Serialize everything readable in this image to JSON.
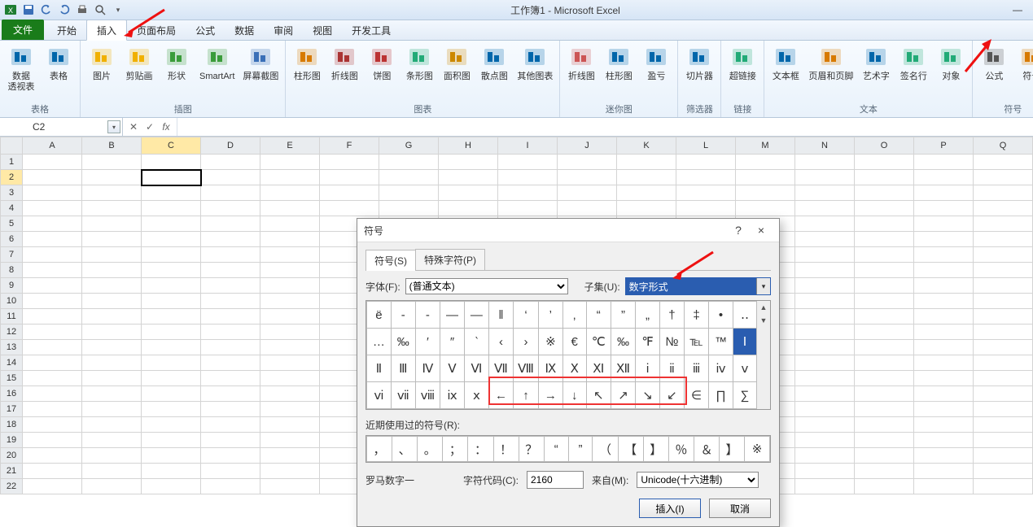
{
  "qat": {
    "title": "工作簿1 - Microsoft Excel"
  },
  "tabs": {
    "file": "文件",
    "items": [
      "开始",
      "插入",
      "页面布局",
      "公式",
      "数据",
      "审阅",
      "视图",
      "开发工具"
    ],
    "active_index": 1
  },
  "ribbon": {
    "groups": [
      {
        "label": "表格",
        "items": [
          {
            "name": "pivot",
            "label": "数据\n透视表"
          },
          {
            "name": "table",
            "label": "表格"
          }
        ]
      },
      {
        "label": "插图",
        "items": [
          {
            "name": "picture",
            "label": "图片"
          },
          {
            "name": "clipart",
            "label": "剪贴画"
          },
          {
            "name": "shapes",
            "label": "形状"
          },
          {
            "name": "smartart",
            "label": "SmartArt"
          },
          {
            "name": "screenshot",
            "label": "屏幕截图"
          }
        ]
      },
      {
        "label": "图表",
        "items": [
          {
            "name": "column-chart",
            "label": "柱形图"
          },
          {
            "name": "line-chart",
            "label": "折线图"
          },
          {
            "name": "pie-chart",
            "label": "饼图"
          },
          {
            "name": "bar-chart",
            "label": "条形图"
          },
          {
            "name": "area-chart",
            "label": "面积图"
          },
          {
            "name": "scatter-chart",
            "label": "散点图"
          },
          {
            "name": "other-chart",
            "label": "其他图表"
          }
        ]
      },
      {
        "label": "迷你图",
        "items": [
          {
            "name": "sparkline",
            "label": "折线图"
          },
          {
            "name": "sparkcol",
            "label": "柱形图"
          },
          {
            "name": "sparkwl",
            "label": "盈亏"
          }
        ]
      },
      {
        "label": "筛选器",
        "items": [
          {
            "name": "slicer",
            "label": "切片器"
          }
        ]
      },
      {
        "label": "链接",
        "items": [
          {
            "name": "hyper",
            "label": "超链接"
          }
        ]
      },
      {
        "label": "文本",
        "items": [
          {
            "name": "textbox",
            "label": "文本框"
          },
          {
            "name": "headerfooter",
            "label": "页眉和页脚"
          },
          {
            "name": "wordart",
            "label": "艺术字"
          },
          {
            "name": "sigline",
            "label": "签名行"
          },
          {
            "name": "object",
            "label": "对象"
          }
        ]
      },
      {
        "label": "符号",
        "items": [
          {
            "name": "equation",
            "label": "公式"
          },
          {
            "name": "symbol",
            "label": "符号"
          }
        ]
      }
    ]
  },
  "formula": {
    "namebox": "C2",
    "fx": "fx"
  },
  "sheet": {
    "cols": [
      "A",
      "B",
      "C",
      "D",
      "E",
      "F",
      "G",
      "H",
      "I",
      "J",
      "K",
      "L",
      "M",
      "N",
      "O",
      "P",
      "Q"
    ],
    "rows": 22,
    "sel": "C2"
  },
  "dialog": {
    "title": "符号",
    "help": "?",
    "close": "×",
    "tabs": [
      "符号(S)",
      "特殊字符(P)"
    ],
    "active_tab": 0,
    "font_label": "字体(F):",
    "font_value": "(普通文本)",
    "subset_label": "子集(U):",
    "subset_value": "数字形式",
    "grid": [
      [
        "ё",
        "-",
        "‐",
        "—",
        "―",
        "‖",
        "‘",
        "’",
        "‚",
        "“",
        "”",
        "„",
        "†",
        "‡",
        "•",
        "‥"
      ],
      [
        "…",
        "‰",
        "′",
        "″",
        "‵",
        "‹",
        "›",
        "※",
        "€",
        "℃",
        "‰",
        "℉",
        "№",
        "℡",
        "™",
        "Ⅰ"
      ],
      [
        "Ⅱ",
        "Ⅲ",
        "Ⅳ",
        "Ⅴ",
        "Ⅵ",
        "Ⅶ",
        "Ⅷ",
        "Ⅸ",
        "Ⅹ",
        "Ⅺ",
        "Ⅻ",
        "ⅰ",
        "ⅱ",
        "ⅲ",
        "ⅳ",
        "ⅴ"
      ],
      [
        "ⅵ",
        "ⅶ",
        "ⅷ",
        "ⅸ",
        "ⅹ",
        "←",
        "↑",
        "→",
        "↓",
        "↖",
        "↗",
        "↘",
        "↙",
        "∈",
        "∏",
        "∑"
      ]
    ],
    "grid_selected": [
      1,
      15
    ],
    "red_box": {
      "row": 3,
      "col_start": 5,
      "col_end": 12
    },
    "recent_label": "近期使用过的符号(R):",
    "recent": [
      "，",
      "、",
      "。",
      "；",
      "：",
      "！",
      "？",
      "“",
      "”",
      "（",
      "【",
      "】",
      "％",
      "＆",
      "】",
      "※"
    ],
    "name_label": "罗马数字一",
    "code_label": "字符代码(C):",
    "code_value": "2160",
    "from_label": "来自(M):",
    "from_value": "Unicode(十六进制)",
    "insert_btn": "插入(I)",
    "cancel_btn": "取消"
  }
}
